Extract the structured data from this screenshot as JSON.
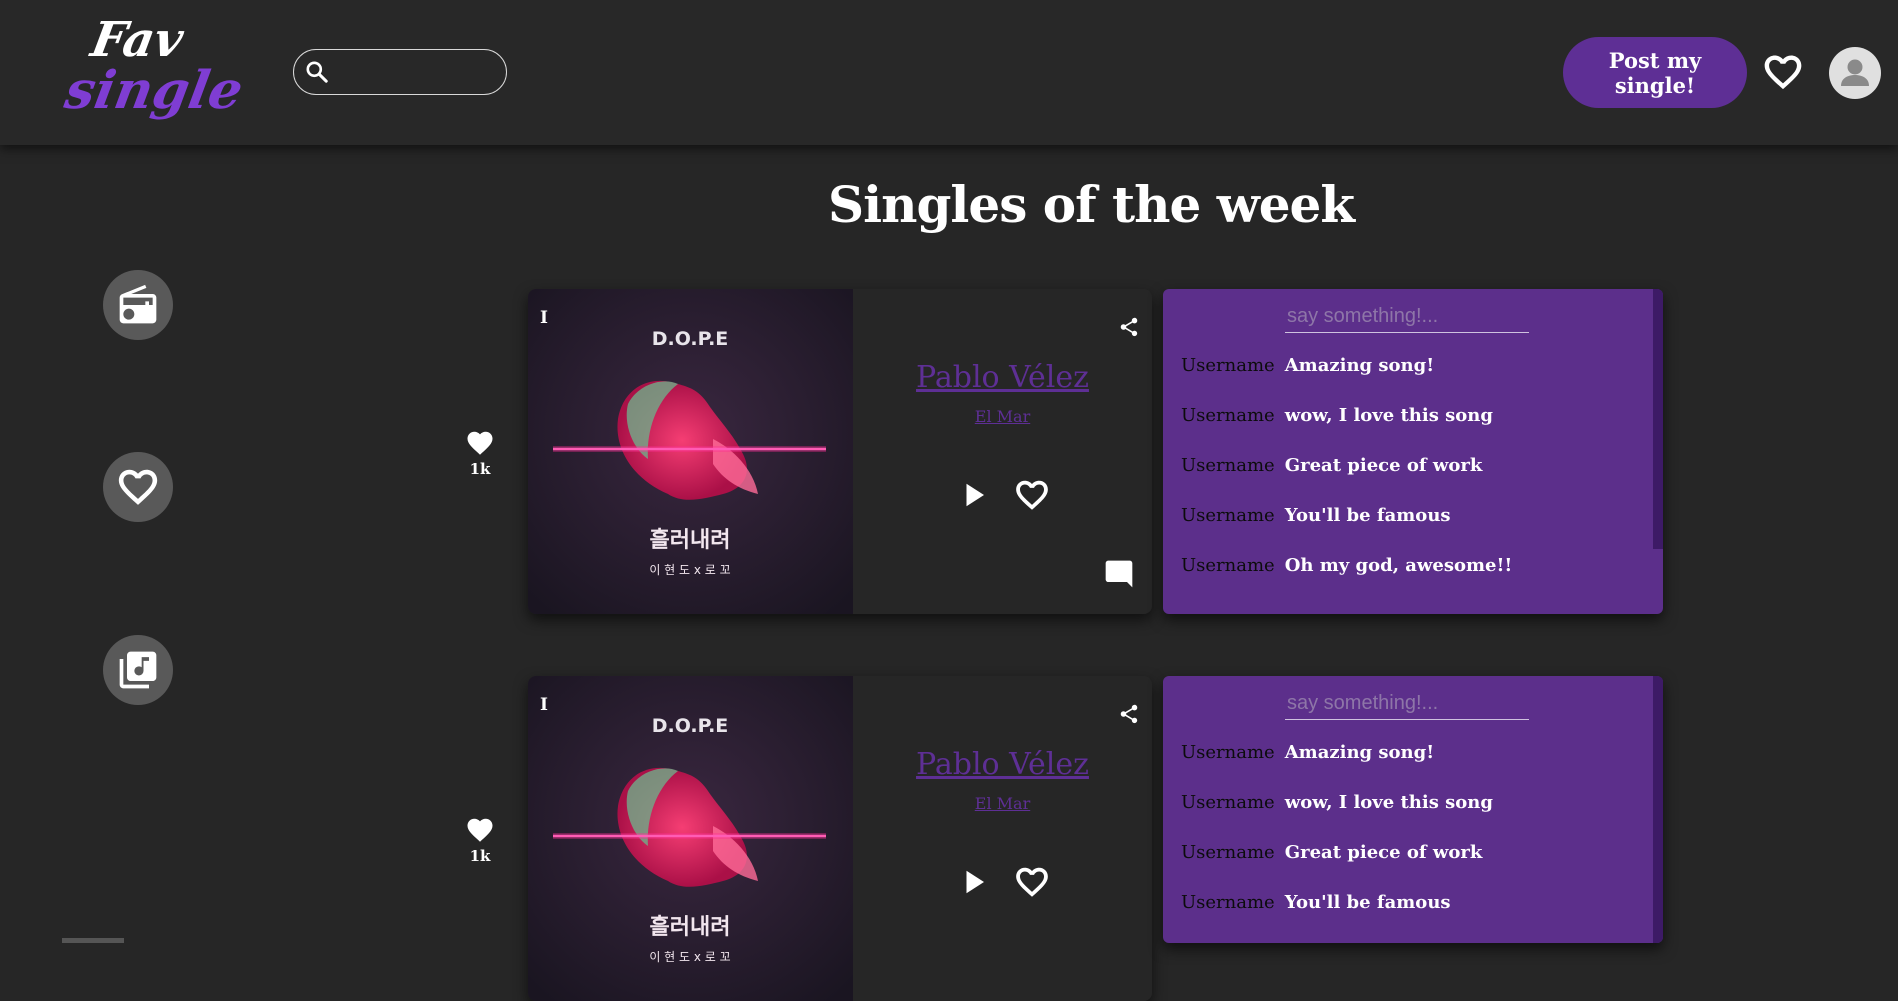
{
  "header": {
    "logo_line1": "Fav",
    "logo_line2": "single",
    "search_placeholder": "",
    "post_button": "Post my single!",
    "favorites_icon": "heart-outline-icon",
    "profile_icon": "account-circle-icon"
  },
  "sidebar": {
    "items": [
      {
        "icon": "radio-icon"
      },
      {
        "icon": "heart-icon"
      },
      {
        "icon": "music-library-icon"
      }
    ]
  },
  "page_title": "Singles of the week",
  "singles": [
    {
      "rank": "I",
      "likes": "1k",
      "artist": "Pablo Vélez",
      "song": "El Mar",
      "cover": {
        "title": "D.O.P.E",
        "korean_title": "흘러내려",
        "credits": "이 현 도   x   로   꼬"
      },
      "comment_placeholder": "say something!...",
      "comments": [
        {
          "user": "Username",
          "text": "Amazing song!"
        },
        {
          "user": "Username",
          "text": "wow, I love this song"
        },
        {
          "user": "Username",
          "text": "Great piece of work"
        },
        {
          "user": "Username",
          "text": "You'll be famous"
        },
        {
          "user": "Username",
          "text": "Oh my god, awesome!!"
        }
      ]
    },
    {
      "rank": "I",
      "likes": "1k",
      "artist": "Pablo Vélez",
      "song": "El Mar",
      "cover": {
        "title": "D.O.P.E",
        "korean_title": "흘러내려",
        "credits": "이 현 도   x   로   꼬"
      },
      "comment_placeholder": "say something!...",
      "comments": [
        {
          "user": "Username",
          "text": "Amazing song!"
        },
        {
          "user": "Username",
          "text": "wow, I love this song"
        },
        {
          "user": "Username",
          "text": "Great piece of work"
        },
        {
          "user": "Username",
          "text": "You'll be famous"
        }
      ]
    }
  ],
  "colors": {
    "accent": "#5e2f95",
    "panel": "#5c2f8b",
    "background": "#262626"
  }
}
